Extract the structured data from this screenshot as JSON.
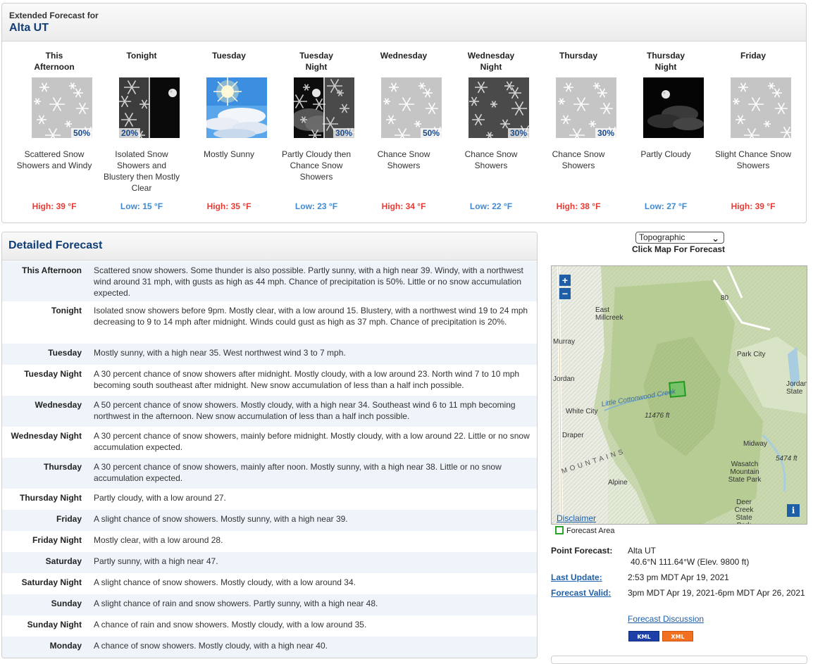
{
  "extended": {
    "header_small": "Extended Forecast for",
    "location": "Alta UT",
    "periods": [
      {
        "name_line1": "This",
        "name_line2": "Afternoon",
        "icon": "snow-showers-day",
        "pop": "50%",
        "pop_side": "right",
        "short": "Scattered Snow Showers and Windy",
        "temp": "High: 39 °F",
        "temp_type": "high"
      },
      {
        "name_line1": "Tonight",
        "name_line2": "",
        "icon": "snow-then-clear-night",
        "pop": "20%",
        "pop_side": "left",
        "short": "Isolated Snow Showers and Blustery then Mostly Clear",
        "temp": "Low: 15 °F",
        "temp_type": "low"
      },
      {
        "name_line1": "Tuesday",
        "name_line2": "",
        "icon": "mostly-sunny",
        "pop": "",
        "pop_side": "",
        "short": "Mostly Sunny",
        "temp": "High: 35 °F",
        "temp_type": "high"
      },
      {
        "name_line1": "Tuesday",
        "name_line2": "Night",
        "icon": "cloudy-then-snow-night",
        "pop": "30%",
        "pop_side": "right",
        "short": "Partly Cloudy then Chance Snow Showers",
        "temp": "Low: 23 °F",
        "temp_type": "low"
      },
      {
        "name_line1": "Wednesday",
        "name_line2": "",
        "icon": "snow-showers-day",
        "pop": "50%",
        "pop_side": "right",
        "short": "Chance Snow Showers",
        "temp": "High: 34 °F",
        "temp_type": "high"
      },
      {
        "name_line1": "Wednesday",
        "name_line2": "Night",
        "icon": "snow-showers-night",
        "pop": "30%",
        "pop_side": "right",
        "short": "Chance Snow Showers",
        "temp": "Low: 22 °F",
        "temp_type": "low"
      },
      {
        "name_line1": "Thursday",
        "name_line2": "",
        "icon": "snow-showers-day",
        "pop": "30%",
        "pop_side": "right",
        "short": "Chance Snow Showers",
        "temp": "High: 38 °F",
        "temp_type": "high"
      },
      {
        "name_line1": "Thursday",
        "name_line2": "Night",
        "icon": "partly-cloudy-night",
        "pop": "",
        "pop_side": "",
        "short": "Partly Cloudy",
        "temp": "Low: 27 °F",
        "temp_type": "low"
      },
      {
        "name_line1": "Friday",
        "name_line2": "",
        "icon": "snow-showers-day",
        "pop": "",
        "pop_side": "",
        "short": "Slight Chance Snow Showers",
        "temp": "High: 39 °F",
        "temp_type": "high"
      }
    ]
  },
  "detailed": {
    "title": "Detailed Forecast",
    "rows": [
      {
        "label": "This Afternoon",
        "text": "Scattered snow showers. Some thunder is also possible. Partly sunny, with a high near 39. Windy, with a northwest wind around 31 mph, with gusts as high as 44 mph. Chance of precipitation is 50%. Little or no snow accumulation expected."
      },
      {
        "label": "Tonight",
        "text": "Isolated snow showers before 9pm. Mostly clear, with a low around 15. Blustery, with a northwest wind 19 to 24 mph decreasing to 9 to 14 mph after midnight. Winds could gust as high as 37 mph. Chance of precipitation is 20%."
      },
      {
        "label": "Tuesday",
        "text": "Mostly sunny, with a high near 35. West northwest wind 3 to 7 mph."
      },
      {
        "label": "Tuesday Night",
        "text": "A 30 percent chance of snow showers after midnight. Mostly cloudy, with a low around 23. North wind 7 to 10 mph becoming south southeast after midnight. New snow accumulation of less than a half inch possible."
      },
      {
        "label": "Wednesday",
        "text": "A 50 percent chance of snow showers. Mostly cloudy, with a high near 34. Southeast wind 6 to 11 mph becoming northwest in the afternoon. New snow accumulation of less than a half inch possible."
      },
      {
        "label": "Wednesday Night",
        "text": "A 30 percent chance of snow showers, mainly before midnight. Mostly cloudy, with a low around 22. Little or no snow accumulation expected."
      },
      {
        "label": "Thursday",
        "text": "A 30 percent chance of snow showers, mainly after noon. Mostly sunny, with a high near 38. Little or no snow accumulation expected."
      },
      {
        "label": "Thursday Night",
        "text": "Partly cloudy, with a low around 27."
      },
      {
        "label": "Friday",
        "text": "A slight chance of snow showers. Mostly sunny, with a high near 39."
      },
      {
        "label": "Friday Night",
        "text": "Mostly clear, with a low around 28."
      },
      {
        "label": "Saturday",
        "text": "Partly sunny, with a high near 47."
      },
      {
        "label": "Saturday Night",
        "text": "A slight chance of snow showers. Mostly cloudy, with a low around 34."
      },
      {
        "label": "Sunday",
        "text": "A slight chance of rain and snow showers. Partly sunny, with a high near 48."
      },
      {
        "label": "Sunday Night",
        "text": "A chance of rain and snow showers. Mostly cloudy, with a low around 35."
      },
      {
        "label": "Monday",
        "text": "A chance of snow showers. Mostly cloudy, with a high near 40."
      }
    ]
  },
  "map": {
    "select_value": "Topographic",
    "caption": "Click Map For Forecast",
    "zoom_in": "+",
    "zoom_out": "−",
    "labels": [
      "East Millcreek",
      "Murray",
      "Jordan",
      "White City",
      "Draper",
      "Alpine",
      "Park City",
      "Jordanelle State",
      "Midway",
      "Wasatch Mountain State Park",
      "Deer Creek State Park",
      "Little Cottonwood Creek",
      "11476 ft",
      "5474 ft",
      "80",
      "MOUNTAINS"
    ],
    "info": "i",
    "disclaimer": "Disclaimer",
    "legend": "Forecast Area"
  },
  "point": {
    "label_point": "Point Forecast:",
    "location": "Alta UT",
    "coords": "40.6°N 111.64°W (Elev. 9800 ft)",
    "label_update": "Last Update",
    "update": "2:53 pm MDT Apr 19, 2021",
    "label_valid": "Forecast Valid",
    "valid": "3pm MDT Apr 19, 2021-6pm MDT Apr 26, 2021",
    "discussion": "Forecast Discussion",
    "kml": "KML",
    "xml": "XML"
  }
}
